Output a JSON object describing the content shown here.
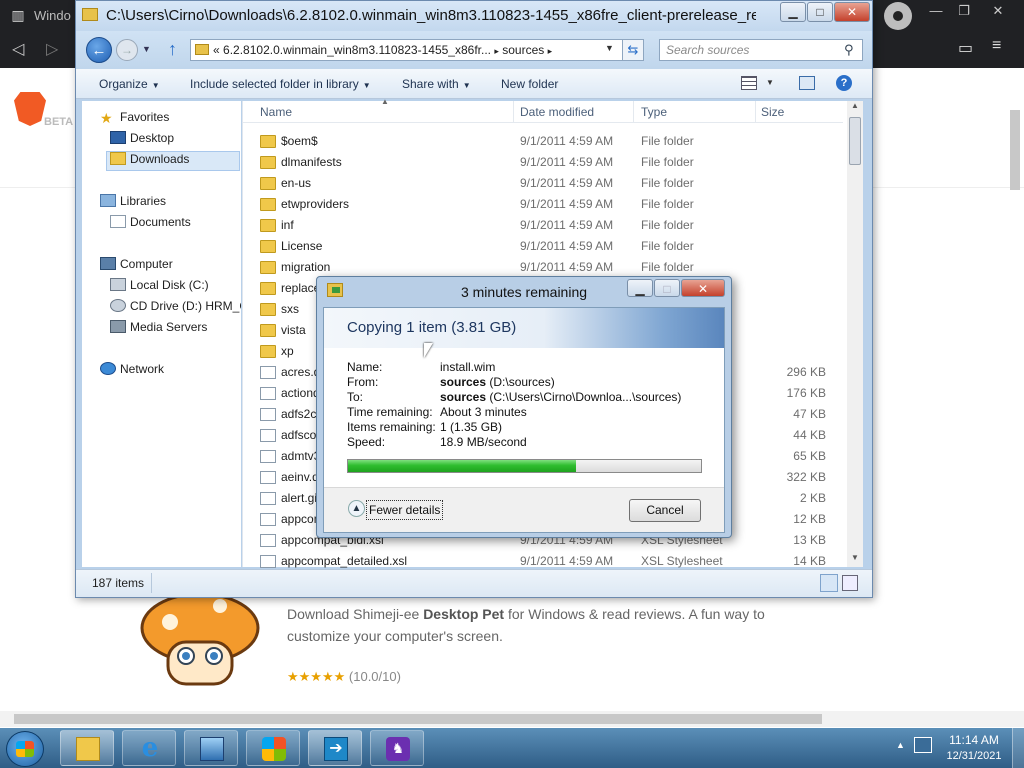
{
  "browser": {
    "tab_title": "Windo",
    "beta_label": "BETA",
    "card": {
      "description_pre": "Download Shimeji-ee ",
      "description_bold": "Desktop Pet",
      "description_post": " for Windows & read reviews. A fun way to customize your computer's screen.",
      "stars": "★★★★★",
      "rating": "(10.0/10)"
    }
  },
  "explorer": {
    "title": "C:\\Users\\Cirno\\Downloads\\6.2.8102.0.winmain_win8m3.110823-1455_x86fre_client-prerelease_retail_",
    "address_prefix": "«",
    "address_path": "6.2.8102.0.winmain_win8m3.110823-1455_x86fr...",
    "address_sep": "▸",
    "address_current": "sources",
    "search_placeholder": "Search sources",
    "commands": {
      "organize": "Organize",
      "include": "Include selected folder in library",
      "share": "Share with",
      "new_folder": "New folder"
    },
    "nav": {
      "favorites": "Favorites",
      "desktop": "Desktop",
      "downloads": "Downloads",
      "libraries": "Libraries",
      "documents": "Documents",
      "computer": "Computer",
      "local_disk": "Local Disk (C:)",
      "cd_drive": "CD Drive (D:) HRM_C",
      "media_servers": "Media Servers",
      "network": "Network"
    },
    "columns": {
      "name": "Name",
      "date": "Date modified",
      "type": "Type",
      "size": "Size"
    },
    "files": [
      {
        "name": "$oem$",
        "date": "9/1/2011 4:59 AM",
        "type": "File folder",
        "size": "",
        "kind": "folder"
      },
      {
        "name": "dlmanifests",
        "date": "9/1/2011 4:59 AM",
        "type": "File folder",
        "size": "",
        "kind": "folder"
      },
      {
        "name": "en-us",
        "date": "9/1/2011 4:59 AM",
        "type": "File folder",
        "size": "",
        "kind": "folder"
      },
      {
        "name": "etwproviders",
        "date": "9/1/2011 4:59 AM",
        "type": "File folder",
        "size": "",
        "kind": "folder"
      },
      {
        "name": "inf",
        "date": "9/1/2011 4:59 AM",
        "type": "File folder",
        "size": "",
        "kind": "folder"
      },
      {
        "name": "License",
        "date": "9/1/2011 4:59 AM",
        "type": "File folder",
        "size": "",
        "kind": "folder"
      },
      {
        "name": "migration",
        "date": "9/1/2011 4:59 AM",
        "type": "File folder",
        "size": "",
        "kind": "folder"
      },
      {
        "name": "replace",
        "date": "",
        "type": "",
        "size": "",
        "kind": "folder"
      },
      {
        "name": "sxs",
        "date": "",
        "type": "",
        "size": "",
        "kind": "folder"
      },
      {
        "name": "vista",
        "date": "",
        "type": "",
        "size": "",
        "kind": "folder"
      },
      {
        "name": "xp",
        "date": "",
        "type": "",
        "size": "",
        "kind": "folder"
      },
      {
        "name": "acres.d",
        "date": "",
        "type": "",
        "size": "296 KB",
        "kind": "doc"
      },
      {
        "name": "actionq",
        "date": "",
        "type": "",
        "size": "176 KB",
        "kind": "doc"
      },
      {
        "name": "adfs2co",
        "date": "",
        "type": "",
        "size": "47 KB",
        "kind": "doc"
      },
      {
        "name": "adfscor",
        "date": "",
        "type": "",
        "size": "44 KB",
        "kind": "doc"
      },
      {
        "name": "admtv3",
        "date": "",
        "type": "",
        "size": "65 KB",
        "kind": "doc"
      },
      {
        "name": "aeinv.d",
        "date": "",
        "type": "",
        "size": "322 KB",
        "kind": "doc"
      },
      {
        "name": "alert.gi",
        "date": "",
        "type": "",
        "size": "2 KB",
        "kind": "doc"
      },
      {
        "name": "appcom",
        "date": "",
        "type": "",
        "size": "12 KB",
        "kind": "doc"
      },
      {
        "name": "appcompat_bidi.xsl",
        "date": "9/1/2011 4:59 AM",
        "type": "XSL Stylesheet",
        "size": "13 KB",
        "kind": "doc"
      },
      {
        "name": "appcompat_detailed.xsl",
        "date": "9/1/2011 4:59 AM",
        "type": "XSL Stylesheet",
        "size": "14 KB",
        "kind": "doc"
      }
    ],
    "item_count": "187 items"
  },
  "copy_dialog": {
    "title": "3 minutes remaining",
    "heading": "Copying 1 item (3.81 GB)",
    "name_label": "Name:",
    "name_value": "install.wim",
    "from_label": "From:",
    "from_bold": "sources",
    "from_rest": " (D:\\sources)",
    "to_label": "To:",
    "to_bold": "sources",
    "to_rest": " (C:\\Users\\Cirno\\Downloa...\\sources)",
    "time_label": "Time remaining:",
    "time_value": "About 3 minutes",
    "items_label": "Items remaining:",
    "items_value": "1 (1.35 GB)",
    "speed_label": "Speed:",
    "speed_value": "18.9 MB/second",
    "progress_fraction": 0.645,
    "fewer_details": "Fewer details",
    "cancel": "Cancel"
  },
  "taskbar": {
    "time": "11:14 AM",
    "date": "12/31/2021"
  },
  "colors": {
    "progress_green": "#2fbd2f",
    "aero_blue": "#b9d1ea",
    "taskbar": "#2f5d86"
  }
}
